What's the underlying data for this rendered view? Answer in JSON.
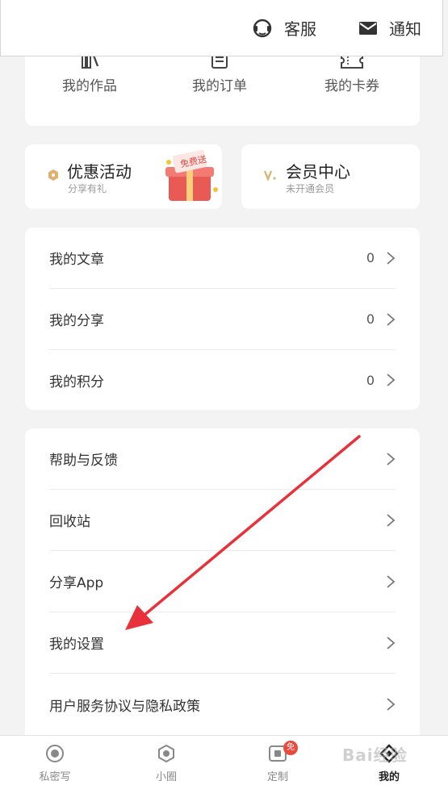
{
  "header": {
    "service_label": "客服",
    "notify_label": "通知"
  },
  "works": [
    {
      "label": "我的作品",
      "icon": "books-icon"
    },
    {
      "label": "我的订单",
      "icon": "order-icon"
    },
    {
      "label": "我的卡券",
      "icon": "ticket-icon"
    }
  ],
  "promos": [
    {
      "title": "优惠活动",
      "subtitle": "分享有礼",
      "icon": "coin-icon",
      "accent": "#e0b070"
    },
    {
      "title": "会员中心",
      "subtitle": "未开通会员",
      "icon": "vip-icon",
      "accent": "#d8b878"
    }
  ],
  "gift_text": "免费送",
  "list1": [
    {
      "label": "我的文章",
      "value": "0"
    },
    {
      "label": "我的分享",
      "value": "0"
    },
    {
      "label": "我的积分",
      "value": "0"
    }
  ],
  "list2": [
    {
      "label": "帮助与反馈"
    },
    {
      "label": "回收站"
    },
    {
      "label": "分享App"
    },
    {
      "label": "我的设置"
    },
    {
      "label": "用户服务协议与隐私政策"
    }
  ],
  "tabs": [
    {
      "label": "私密写",
      "icon": "record-icon"
    },
    {
      "label": "小圈",
      "icon": "hexagon-icon"
    },
    {
      "label": "定制",
      "icon": "custom-icon",
      "badge": "免"
    },
    {
      "label": "我的",
      "icon": "diamond-icon",
      "active": true
    }
  ],
  "watermark": "Bai经验",
  "colors": {
    "annotation_arrow": "#e8313b",
    "badge": "#e84a3c"
  }
}
